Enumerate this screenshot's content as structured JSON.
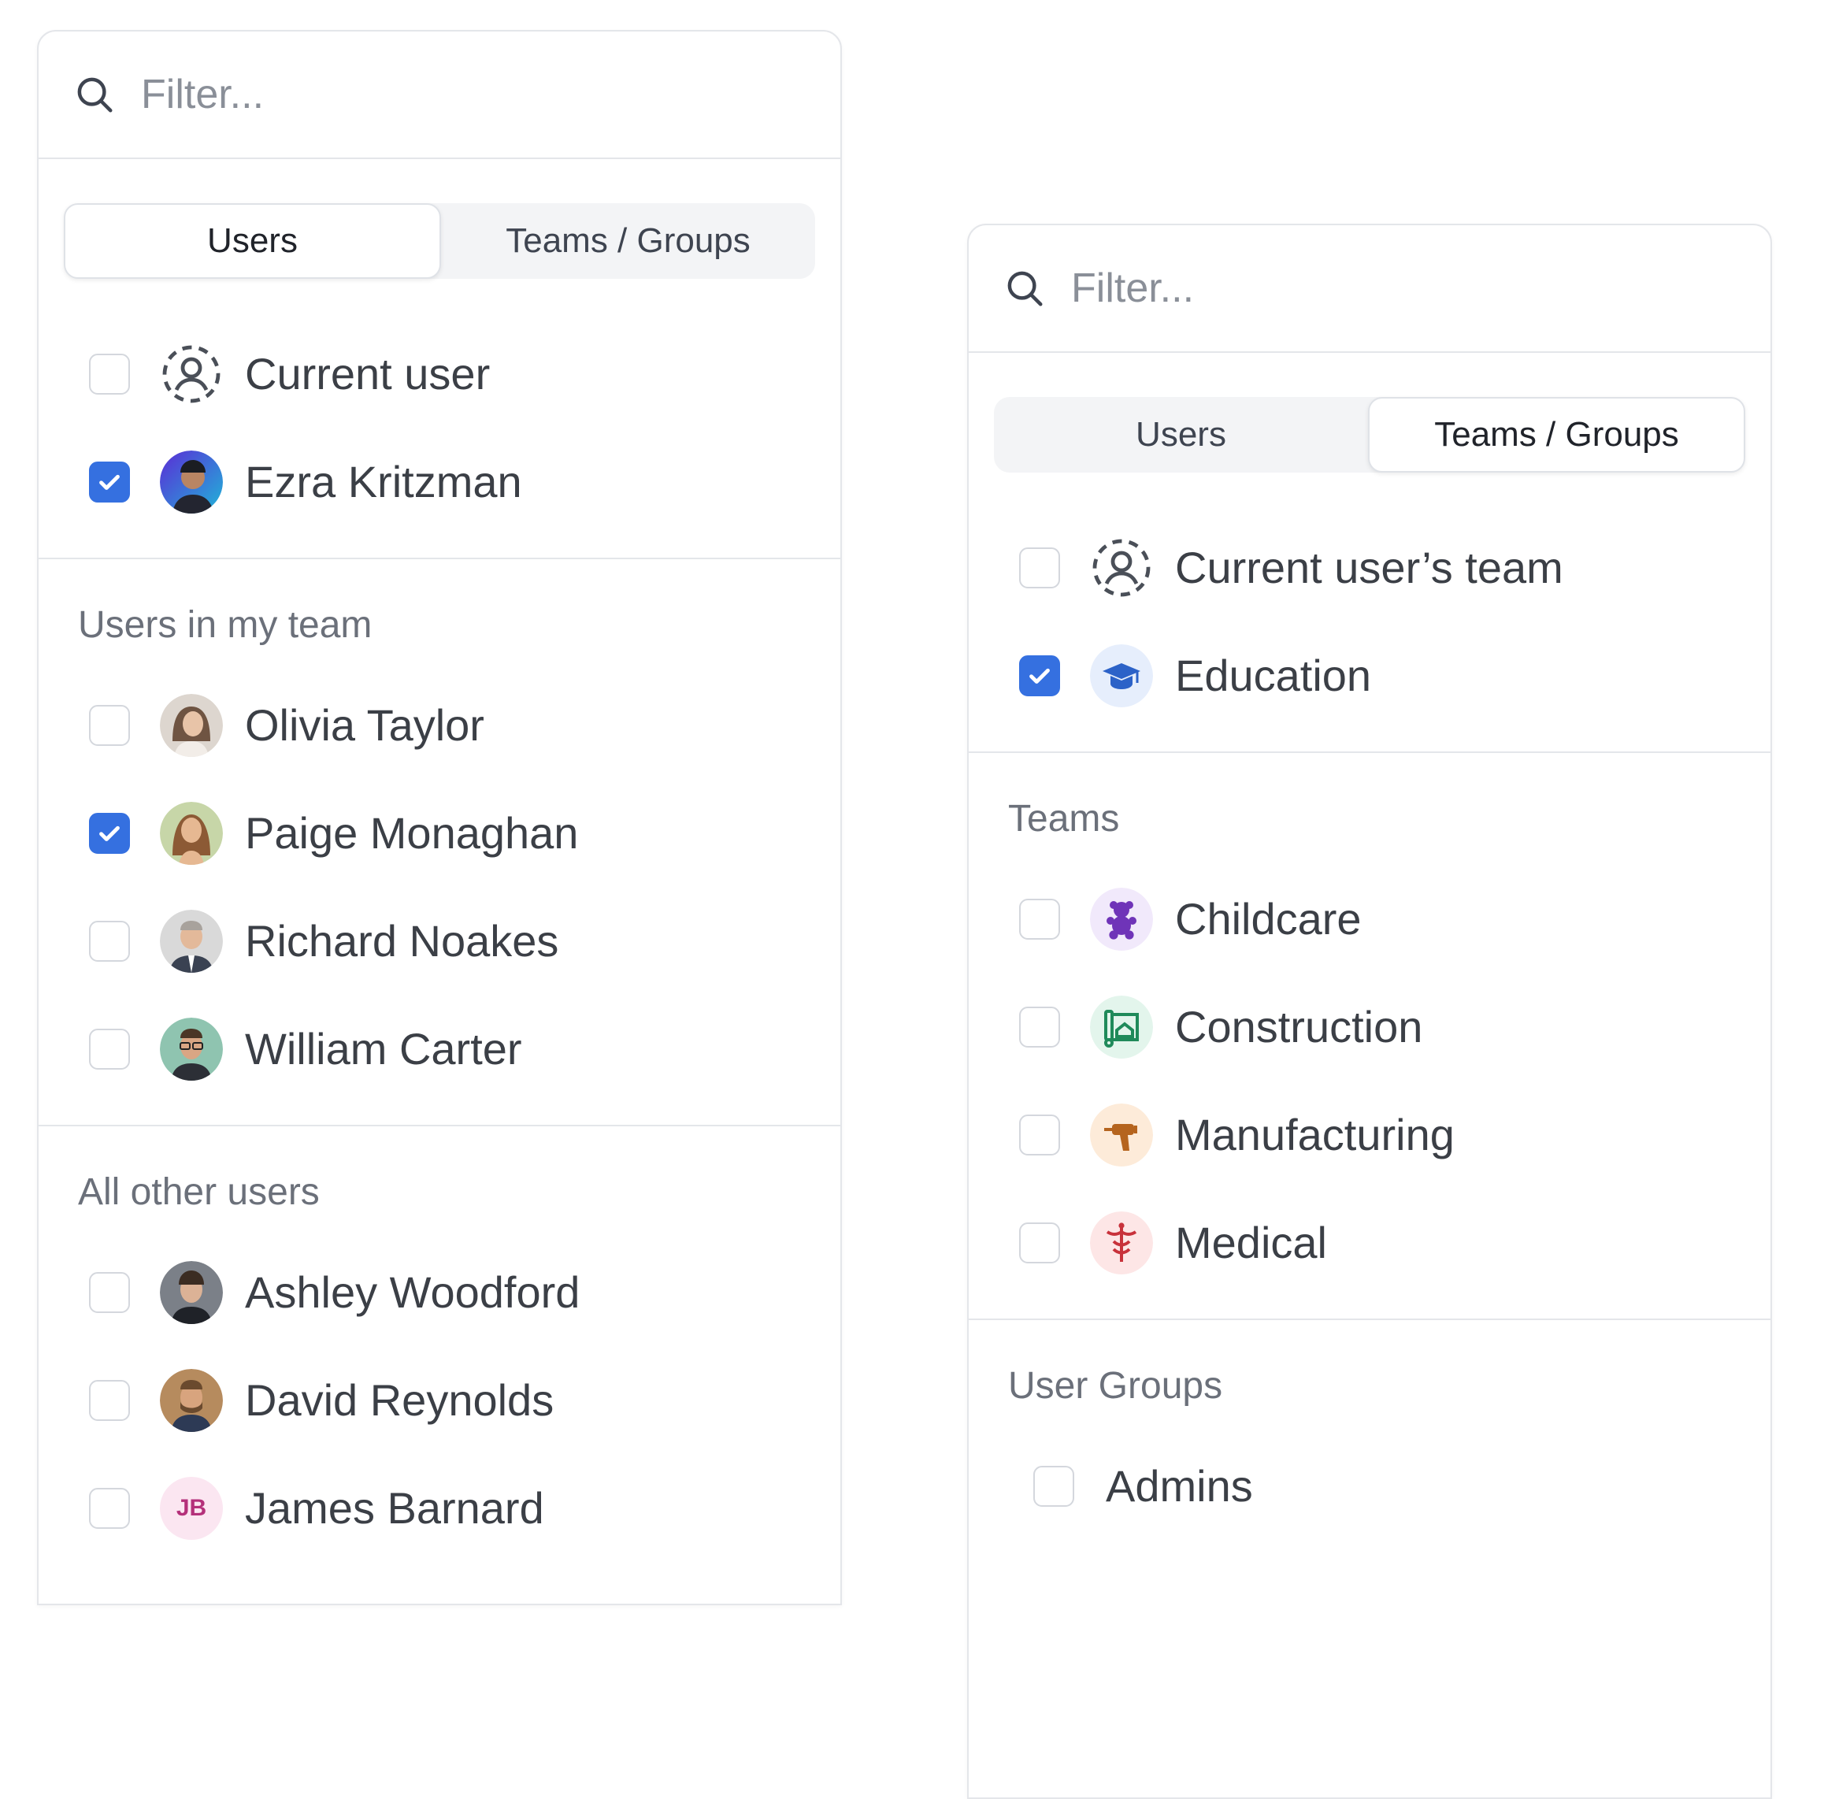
{
  "panel_users": {
    "filter_placeholder": "Filter...",
    "tabs": [
      "Users",
      "Teams / Groups"
    ],
    "active_tab": "Users",
    "top_items": [
      {
        "label": "Current user",
        "checked": false,
        "icon": "dashed-user-icon"
      },
      {
        "label": "Ezra Kritzman",
        "checked": true,
        "icon": "avatar"
      }
    ],
    "sections": [
      {
        "title": "Users in my team",
        "items": [
          {
            "label": "Olivia Taylor",
            "checked": false
          },
          {
            "label": "Paige Monaghan",
            "checked": true
          },
          {
            "label": "Richard Noakes",
            "checked": false
          },
          {
            "label": "William Carter",
            "checked": false
          }
        ]
      },
      {
        "title": "All other users",
        "items": [
          {
            "label": "Ashley Woodford",
            "checked": false
          },
          {
            "label": "David Reynolds",
            "checked": false
          },
          {
            "label": "James Barnard",
            "checked": false,
            "initials": "JB"
          }
        ]
      }
    ]
  },
  "panel_teams": {
    "filter_placeholder": "Filter...",
    "tabs": [
      "Users",
      "Teams / Groups"
    ],
    "active_tab": "Teams / Groups",
    "top_items": [
      {
        "label": "Current user’s team",
        "checked": false,
        "icon": "dashed-user-icon"
      },
      {
        "label": "Education",
        "checked": true,
        "icon": "graduation-cap-icon"
      }
    ],
    "sections": [
      {
        "title": "Teams",
        "items": [
          {
            "label": "Childcare",
            "checked": false,
            "icon": "teddy-bear-icon"
          },
          {
            "label": "Construction",
            "checked": false,
            "icon": "blueprint-icon"
          },
          {
            "label": "Manufacturing",
            "checked": false,
            "icon": "drill-icon"
          },
          {
            "label": "Medical",
            "checked": false,
            "icon": "caduceus-icon"
          }
        ]
      },
      {
        "title": "User Groups",
        "items": [
          {
            "label": "Admins",
            "checked": false
          }
        ]
      }
    ]
  },
  "colors": {
    "accent": "#3570e0",
    "education_bg": "#e6eefc",
    "childcare_bg": "#f1e9fb",
    "construction_bg": "#e3f5ec",
    "manufacturing_bg": "#fdebd9",
    "medical_bg": "#fde6e6"
  }
}
